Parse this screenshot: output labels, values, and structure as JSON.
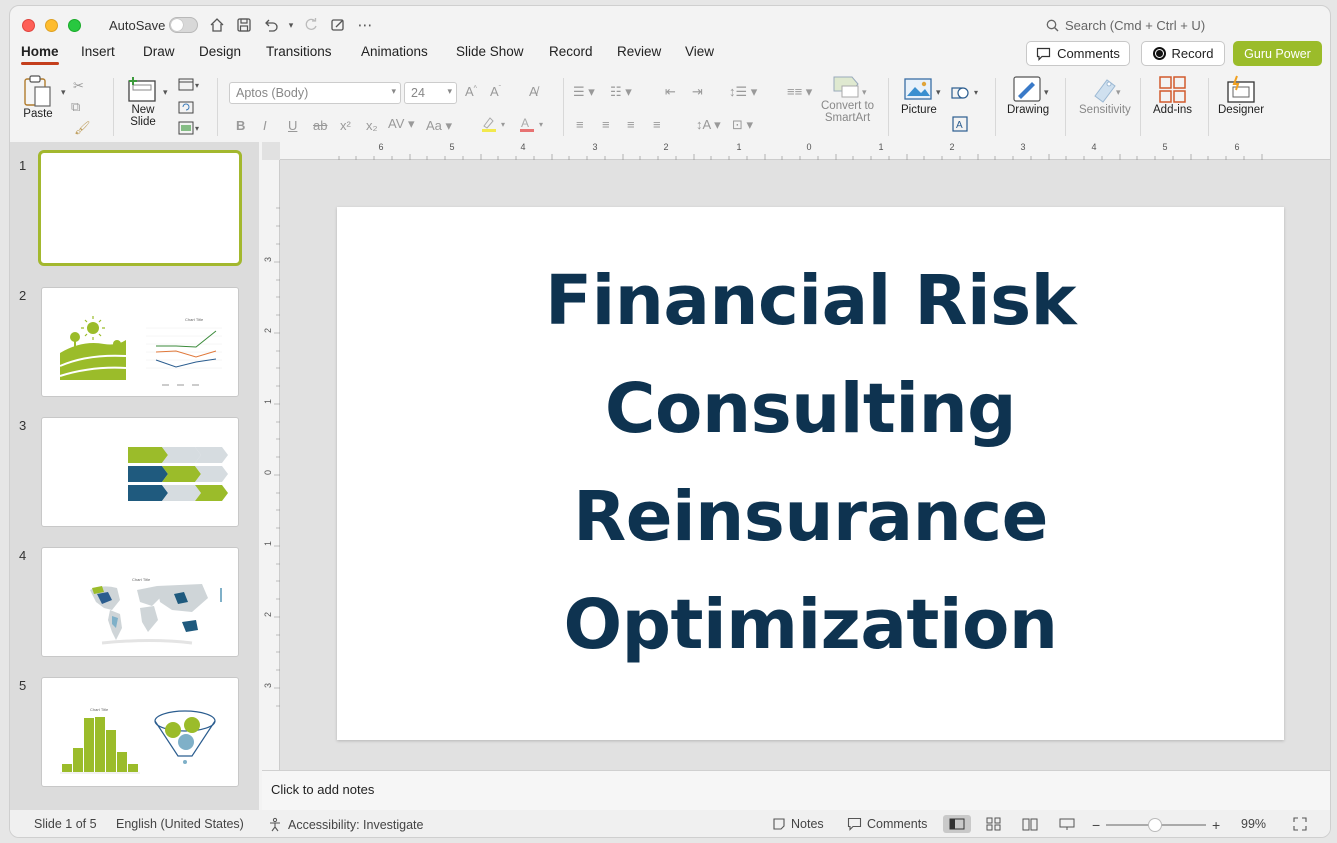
{
  "titlebar": {
    "autosave_label": "AutoSave",
    "search_placeholder": "Search (Cmd + Ctrl + U)"
  },
  "tabs": [
    {
      "label": "Home",
      "active": true
    },
    {
      "label": "Insert"
    },
    {
      "label": "Draw"
    },
    {
      "label": "Design"
    },
    {
      "label": "Transitions"
    },
    {
      "label": "Animations"
    },
    {
      "label": "Slide Show"
    },
    {
      "label": "Record"
    },
    {
      "label": "Review"
    },
    {
      "label": "View"
    }
  ],
  "header_buttons": {
    "comments": "Comments",
    "record": "Record",
    "guru": "Guru Power"
  },
  "ribbon": {
    "paste": "Paste",
    "new_slide_line1": "New",
    "new_slide_line2": "Slide",
    "font_name": "Aptos (Body)",
    "font_size": "24",
    "convert_line1": "Convert to",
    "convert_line2": "SmartArt",
    "picture": "Picture",
    "drawing": "Drawing",
    "sensitivity": "Sensitivity",
    "addins": "Add-ins",
    "designer": "Designer"
  },
  "thumbnails": {
    "numbers": [
      "1",
      "2",
      "3",
      "4",
      "5"
    ],
    "selected": 1,
    "chart_title": "Chart Title"
  },
  "slide": {
    "title_lines": [
      "Financial Risk",
      "Consulting",
      "Reinsurance",
      "Optimization"
    ]
  },
  "ruler_h": [
    "6",
    "5",
    "4",
    "3",
    "2",
    "1",
    "0",
    "1",
    "2",
    "3",
    "4",
    "5",
    "6"
  ],
  "ruler_v": [
    "3",
    "2",
    "1",
    "0",
    "1",
    "2",
    "3"
  ],
  "notes": {
    "placeholder": "Click to add notes"
  },
  "status": {
    "slide_info": "Slide 1 of 5",
    "language": "English (United States)",
    "accessibility": "Accessibility: Investigate",
    "notes": "Notes",
    "comments": "Comments",
    "zoom": "99%"
  },
  "colors": {
    "title_text": "#0e3350",
    "accent_green": "#9bbc2a",
    "accent_blue": "#1f5a7e",
    "tab_underline": "#c43e1c"
  }
}
